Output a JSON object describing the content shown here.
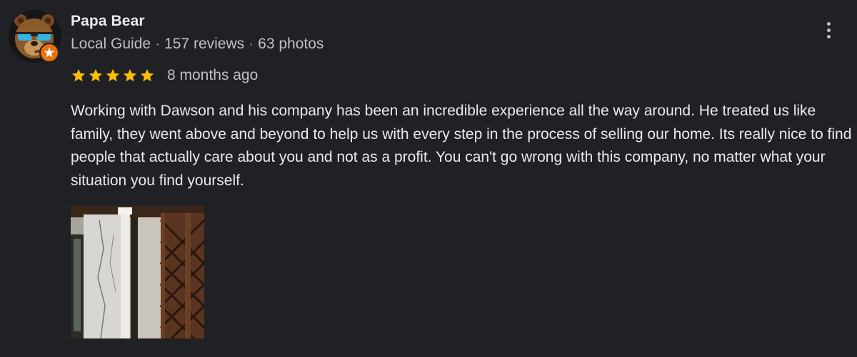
{
  "review": {
    "author": {
      "name": "Papa Bear",
      "level": "Local Guide",
      "reviews": "157 reviews",
      "photos": "63 photos",
      "separator": "·"
    },
    "rating": 5,
    "rating_max": 5,
    "date": "8 months ago",
    "text": "Working with Dawson and his company has been an incredible experience all the way around. He treated us like family, they went above and beyond to help us with every step in the process of selling our home. Its really nice to find people that actually care about you and not as a profit. You can't go wrong with this company, no matter what your situation you find yourself.",
    "photo_count": 1
  },
  "colors": {
    "background": "#202124",
    "star": "#fbbc04",
    "text_primary": "#e8eaed",
    "text_secondary": "#bdc1c6",
    "guide_badge": "#e8710a"
  },
  "icons": {
    "avatar": "bear-avatar-icon",
    "badge": "local-guide-badge-icon",
    "star": "star-icon",
    "more": "more-vert-icon"
  }
}
